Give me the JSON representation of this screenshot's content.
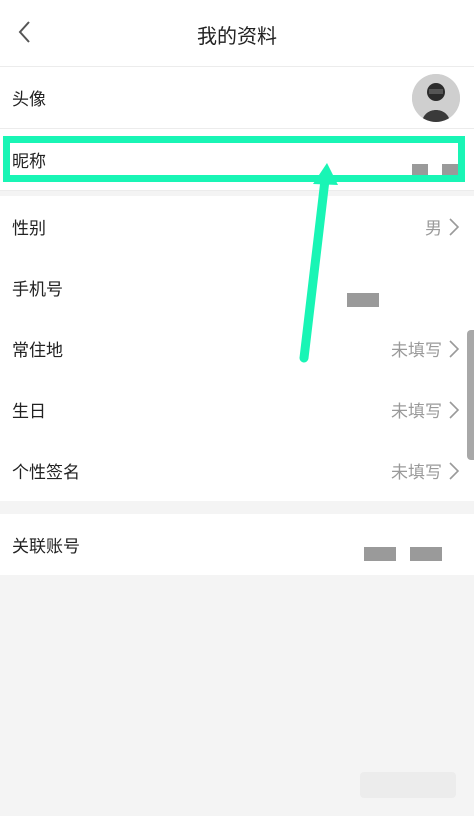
{
  "header": {
    "title": "我的资料",
    "back_icon": "chevron-left-icon"
  },
  "profile": {
    "avatar_label": "头像",
    "nickname_label": "昵称",
    "gender_label": "性别",
    "gender_value": "男",
    "phone_label": "手机号",
    "residence_label": "常住地",
    "residence_value": "未填写",
    "birthday_label": "生日",
    "birthday_value": "未填写",
    "signature_label": "个性签名",
    "signature_value": "未填写"
  },
  "linked": {
    "label": "关联账号"
  },
  "colors": {
    "highlight": "#19f5b5",
    "secondary_text": "#9a9a9a",
    "background": "#f4f4f4"
  }
}
